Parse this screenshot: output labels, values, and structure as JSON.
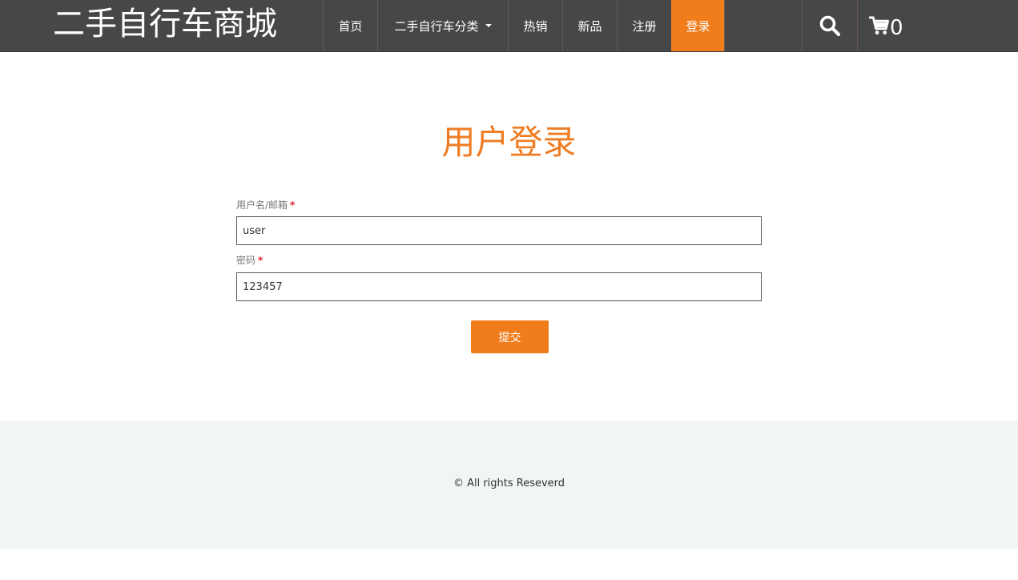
{
  "header": {
    "brand": "二手自行车商城",
    "nav": [
      {
        "label": "首页"
      },
      {
        "label": "二手自行车分类"
      },
      {
        "label": "热销"
      },
      {
        "label": "新品"
      },
      {
        "label": "注册"
      },
      {
        "label": "登录"
      }
    ],
    "cart_count": "0",
    "icons": {
      "search": "search-icon",
      "cart": "shopping-cart-icon",
      "dropdown": "caret-down-icon"
    }
  },
  "login": {
    "title": "用户登录",
    "username_label": "用户名/邮箱",
    "username_value": "user",
    "password_label": "密码",
    "password_value": "123457",
    "required_mark": "*",
    "submit_label": "提交"
  },
  "footer": {
    "copyright": "© All rights Reseverd"
  },
  "colors": {
    "nav_bg": "#474747",
    "accent": "#f17c1c",
    "title": "#ef7c22",
    "footer_bg": "#f2f5f6",
    "required": "#e0192f"
  }
}
